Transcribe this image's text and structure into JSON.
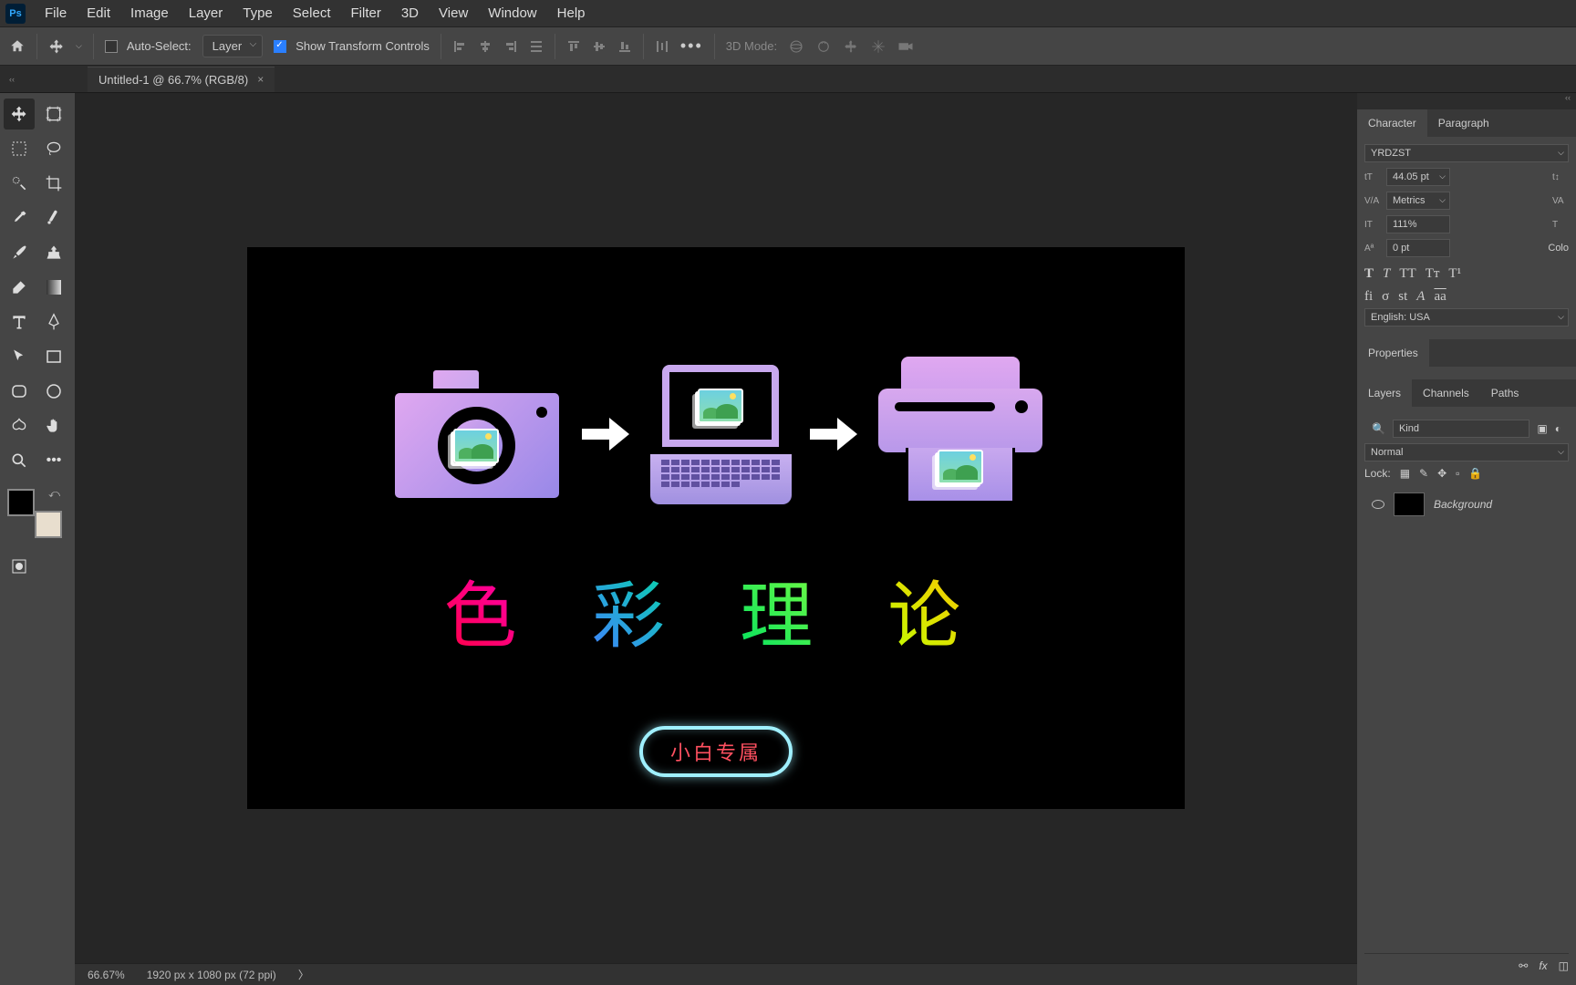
{
  "menubar": {
    "items": [
      "File",
      "Edit",
      "Image",
      "Layer",
      "Type",
      "Select",
      "Filter",
      "3D",
      "View",
      "Window",
      "Help"
    ]
  },
  "optionsbar": {
    "auto_select": "Auto-Select:",
    "layer_mode": "Layer",
    "show_transform": "Show Transform Controls",
    "mode3d": "3D Mode:"
  },
  "tab": {
    "title": "Untitled-1 @ 66.7% (RGB/8)"
  },
  "canvas": {
    "title_chars": [
      "色",
      "彩",
      "理",
      "论"
    ],
    "badge": "小白专属"
  },
  "statusbar": {
    "zoom": "66.67%",
    "dims": "1920 px x 1080 px (72 ppi)"
  },
  "character_panel": {
    "tabs": [
      "Character",
      "Paragraph"
    ],
    "font": "YRDZST",
    "size": "44.05 pt",
    "kerning": "Metrics",
    "vscale": "111%",
    "baseline": "0 pt",
    "color_label": "Colo",
    "lang": "English: USA"
  },
  "properties_panel": {
    "title": "Properties"
  },
  "layers_panel": {
    "tabs": [
      "Layers",
      "Channels",
      "Paths"
    ],
    "kind": "Kind",
    "blend": "Normal",
    "lock_label": "Lock:",
    "bg_layer": "Background"
  }
}
